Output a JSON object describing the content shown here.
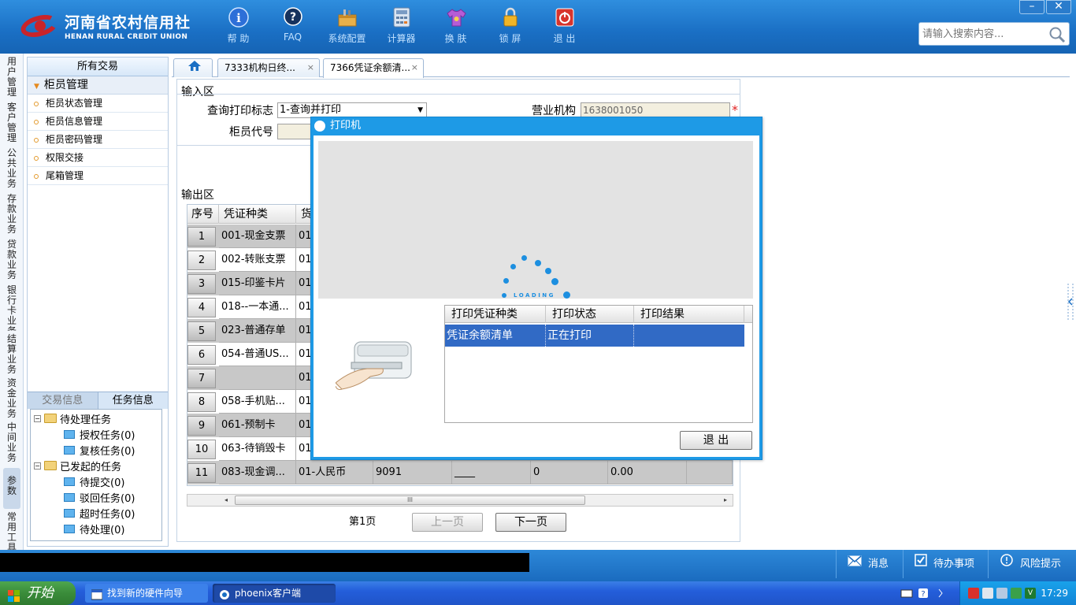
{
  "app": {
    "logo_cn": "河南省农村信用社",
    "logo_en": "HENAN RURAL CREDIT UNION",
    "colors": {
      "header": "#1a6fc4",
      "modal": "#1e9ae6",
      "selection": "#316ac5",
      "required": "#e02020"
    }
  },
  "toolbar": {
    "items": [
      {
        "label": "帮 助",
        "icon": "info-icon"
      },
      {
        "label": "FAQ",
        "icon": "question-icon"
      },
      {
        "label": "系统配置",
        "icon": "toolbox-icon"
      },
      {
        "label": "计算器",
        "icon": "calculator-icon"
      },
      {
        "label": "换 肤",
        "icon": "shirt-icon"
      },
      {
        "label": "锁 屏",
        "icon": "lock-icon"
      },
      {
        "label": "退 出",
        "icon": "power-icon"
      }
    ]
  },
  "window_controls": {
    "minimize": "–",
    "close": "✕"
  },
  "search": {
    "placeholder": "请输入搜索内容..."
  },
  "vertical_nav": [
    {
      "label": "用户管理"
    },
    {
      "label": "客户管理"
    },
    {
      "label": "公共业务"
    },
    {
      "label": "存款业务"
    },
    {
      "label": "贷款业务"
    },
    {
      "label": "银行卡业务"
    },
    {
      "label": "结算业务"
    },
    {
      "label": "资金业务"
    },
    {
      "label": "中间业务"
    },
    {
      "label": "参数"
    },
    {
      "label": "常用工具"
    }
  ],
  "sidebar": {
    "header": "所有交易",
    "group": "柜员管理",
    "items": [
      {
        "label": "柜员状态管理"
      },
      {
        "label": "柜员信息管理"
      },
      {
        "label": "柜员密码管理"
      },
      {
        "label": "权限交接"
      },
      {
        "label": "尾箱管理"
      }
    ],
    "tabs": {
      "tx_info": "交易信息",
      "task_info": "任务信息"
    },
    "tree": {
      "pending": "待处理任务",
      "pending_children": [
        "授权任务(0)",
        "复核任务(0)"
      ],
      "initiated": "已发起的任务",
      "initiated_children": [
        "待提交(0)",
        "驳回任务(0)",
        "超时任务(0)",
        "待处理(0)"
      ]
    }
  },
  "tabs": [
    {
      "label": "7333机构日终...",
      "close": "×"
    },
    {
      "label": "7366凭证余额清...",
      "close": "×"
    }
  ],
  "form": {
    "input_zone_label": "输入区",
    "output_zone_label": "输出区",
    "print_flag_label": "查询打印标志",
    "print_flag_value": "1-查询并打印",
    "org_label": "营业机构",
    "org_value": "1638001050",
    "required_mark": "*",
    "teller_label": "柜员代号",
    "teller_value": ""
  },
  "output_grid": {
    "headers": {
      "seq": "序号",
      "type": "凭证种类",
      "currency": "货"
    },
    "rows": [
      {
        "no": "1",
        "type": "001-现金支票",
        "currency": "01-"
      },
      {
        "no": "2",
        "type": "002-转账支票",
        "currency": "01-"
      },
      {
        "no": "3",
        "type": "015-印鉴卡片",
        "currency": "01-"
      },
      {
        "no": "4",
        "type": "018--一本通...",
        "currency": "01-"
      },
      {
        "no": "5",
        "type": "023-普通存单",
        "currency": "01-"
      },
      {
        "no": "6",
        "type": "054-普通US...",
        "currency": "01-"
      },
      {
        "no": "7",
        "type": "",
        "currency": "01-"
      },
      {
        "no": "8",
        "type": "058-手机贴...",
        "currency": "01-"
      },
      {
        "no": "9",
        "type": "061-预制卡",
        "currency": "01-"
      },
      {
        "no": "10",
        "type": "063-待销毁卡",
        "currency": "01-"
      },
      {
        "no": "11",
        "type": "083-现金调...",
        "currency": "01-人民币",
        "c3": "9091",
        "c4": "____",
        "c5": "0",
        "c6": "0.00"
      }
    ],
    "scroll_grip": "III",
    "scroll_left": "◂",
    "scroll_right": "▸"
  },
  "pager": {
    "page": "第1页",
    "prev": "上一页",
    "next": "下一页"
  },
  "modal": {
    "title": "打印机",
    "loading_text": "LOADING",
    "headers": {
      "type": "打印凭证种类",
      "status": "打印状态",
      "result": "打印结果"
    },
    "row": {
      "type": "凭证余额清单",
      "status": "正在打印",
      "result": ""
    },
    "exit_button": "退 出"
  },
  "statusbar": {
    "message": "消息",
    "todo": "待办事项",
    "risk": "风险提示"
  },
  "taskbar": {
    "start": "开始",
    "items": [
      {
        "label": "找到新的硬件向导"
      },
      {
        "label": "phoenix客户端"
      }
    ],
    "clock": "17:29"
  }
}
